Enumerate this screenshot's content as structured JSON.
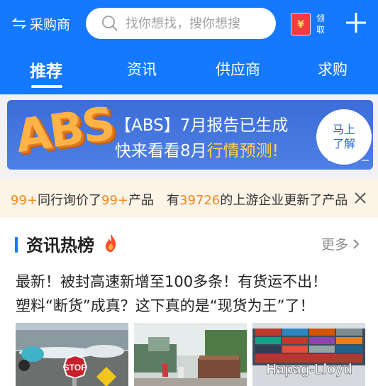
{
  "header": {
    "mode_label": "采购商",
    "search_placeholder": "找你想找，搜你想搜",
    "redpack_claim": "领取",
    "redpack_symbol": "¥"
  },
  "tabs": [
    {
      "label": "推荐",
      "active": true
    },
    {
      "label": "资讯",
      "active": false
    },
    {
      "label": "供应商",
      "active": false
    },
    {
      "label": "求购",
      "active": false
    }
  ],
  "banner": {
    "logo_text": "ABS",
    "line1": "【ABS】7月报告已生成",
    "line2_prefix": "快来看看8月",
    "line2_highlight": "行情预测!",
    "cta": "马上了解"
  },
  "notice": {
    "count1": "99+",
    "text1": "同行询价了",
    "count2": "99+",
    "text2": "产品　有",
    "count3": "39726",
    "text3": "的上游企业更新了产品"
  },
  "section": {
    "title": "资讯热榜",
    "more_label": "更多",
    "headlines": [
      "最新！被封高速新增至100多条！有货运不出！",
      "塑料“断货”成真？这下真的是“现货为王”了！"
    ],
    "thumbnails": [
      {
        "name": "airport-stop-sign-image",
        "sign_text": "STOP"
      },
      {
        "name": "truck-checkpoint-image"
      },
      {
        "name": "shipping-containers-image",
        "brand_text": "Hapag-Lloyd"
      }
    ]
  },
  "colors": {
    "brand_blue": "#1479ff",
    "notice_orange": "#f08a20",
    "notice_bg": "#fdf3e6"
  }
}
